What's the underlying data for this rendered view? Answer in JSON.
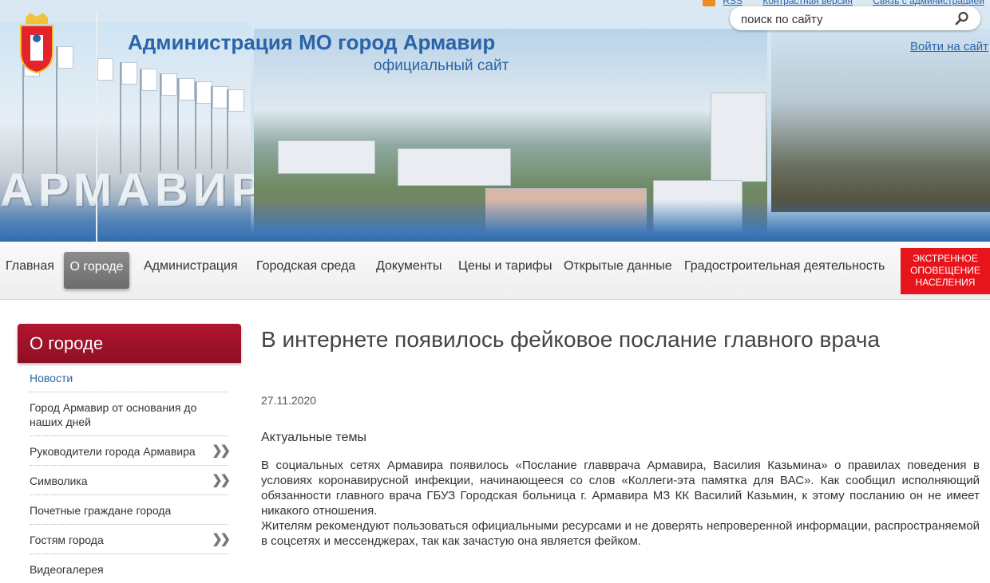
{
  "header": {
    "title": "Администрация МО город Армавир",
    "subtitle": "официальный сайт",
    "sign_text": "АРМАВИР",
    "top_links": [
      "RSS",
      "Контрастная версия",
      "Связь с администрацией"
    ],
    "search_placeholder": "поиск по сайту",
    "login_label": "Войти на сайт"
  },
  "nav": {
    "items": [
      "Главная",
      "О городе",
      "Администрация",
      "Городская среда",
      "Документы",
      "Цены и тарифы",
      "Открытые данные",
      "Градостроительная деятельность"
    ],
    "active_index": 1,
    "emergency_label": "ЭКСТРЕННОЕ ОПОВЕЩЕНИЕ НАСЕЛЕНИЯ"
  },
  "sidebar": {
    "title": "О городе",
    "items": [
      {
        "label": "Новости",
        "active": true,
        "has_children": false
      },
      {
        "label": "Город Армавир от основания до наших дней",
        "active": false,
        "has_children": false
      },
      {
        "label": "Руководители города Армавира",
        "active": false,
        "has_children": true
      },
      {
        "label": "Символика",
        "active": false,
        "has_children": true
      },
      {
        "label": "Почетные граждане города",
        "active": false,
        "has_children": false
      },
      {
        "label": "Гостям города",
        "active": false,
        "has_children": true
      },
      {
        "label": "Видеогалерея",
        "active": false,
        "has_children": false
      }
    ]
  },
  "article": {
    "title": "В интернете появилось фейковое послание главного врача",
    "date": "27.11.2020",
    "section": "Актуальные темы",
    "paragraphs": [
      "В социальных сетях Армавира появилось «Послание главврача Армавира, Василия Казьмина» о правилах поведения в условиях коронавирусной инфекции, начинающееся со слов «Коллеги-эта памятка для ВАС». Как сообщил исполняющий обязанности главного врача ГБУЗ Городская больница г. Армавира МЗ КК Василий Казьмин, к этому посланию он не имеет никакого отношения.",
      "Жителям рекомендуют пользоваться официальными ресурсами и не доверять непроверенной информации, распространяемой в соцсетях и мессенджерах, так как зачастую она является фейком."
    ]
  },
  "colors": {
    "accent_blue": "#2a64a8",
    "sidebar_red": "#9a1128",
    "emergency_red": "#e8141c",
    "nav_active_gray": "#7a7a7a"
  },
  "icons": {
    "search": "search-icon",
    "rss": "rss-icon",
    "chevron": "double-chevron-right-icon",
    "coat": "coat-of-arms-icon"
  }
}
